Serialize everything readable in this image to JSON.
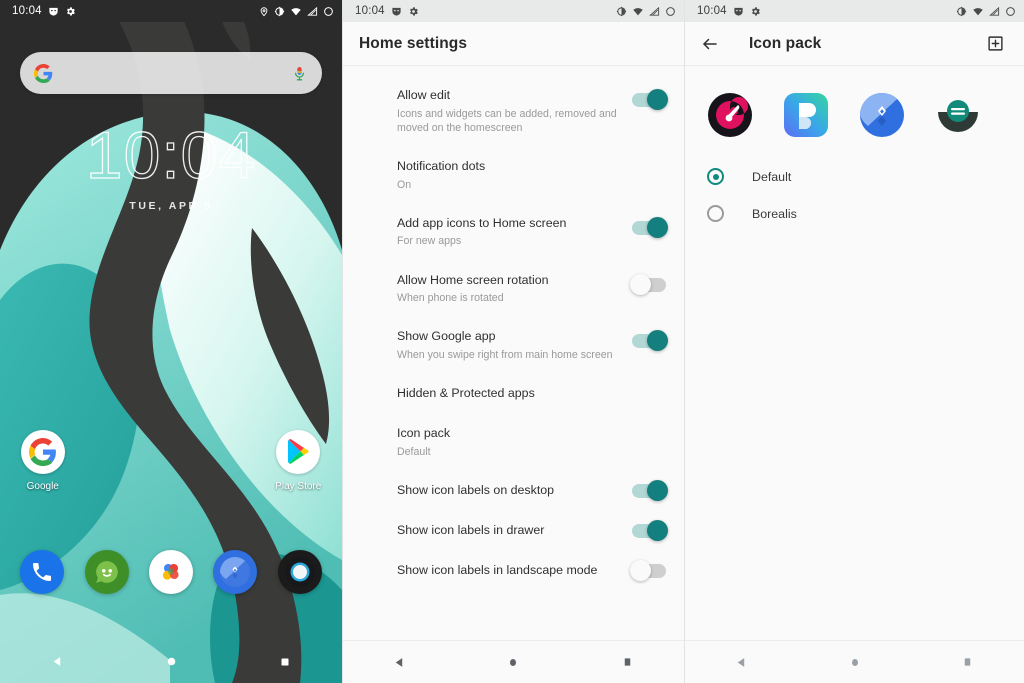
{
  "home_screen": {
    "statusbar": {
      "time": "10:04",
      "left_icons": [
        "mask-icon",
        "gear-icon"
      ],
      "right_icons": [
        "location-pin-icon",
        "brightness-icon",
        "wifi-icon",
        "signal-icon",
        "battery-icon"
      ]
    },
    "search": {
      "placeholder": "",
      "google_logo": "google-g-icon",
      "mic": "microphone-icon"
    },
    "clock_widget": {
      "time": "10:04",
      "date": "TUE, APR 5"
    },
    "apps": [
      {
        "label": "Google",
        "icon": "google-icon"
      },
      {
        "label": "Play Store",
        "icon": "play-store-icon"
      }
    ],
    "dock": [
      {
        "label": "Phone",
        "icon": "phone-icon"
      },
      {
        "label": "Messages",
        "icon": "messages-icon"
      },
      {
        "label": "Photos",
        "icon": "photos-icon"
      },
      {
        "label": "Maps",
        "icon": "maps-icon"
      },
      {
        "label": "Camera",
        "icon": "camera-icon"
      }
    ],
    "navbar": {
      "back": "back-icon",
      "home": "home-icon",
      "recents": "recents-icon"
    }
  },
  "settings_screen": {
    "statusbar": {
      "time": "10:04",
      "left_icons": [
        "mask-icon",
        "gear-icon"
      ],
      "right_icons": [
        "brightness-icon",
        "wifi-icon",
        "signal-icon",
        "battery-icon"
      ]
    },
    "title": "Home settings",
    "rows": [
      {
        "title": "Allow edit",
        "sub": "Icons and widgets can be added, removed and moved on the homescreen",
        "control": "toggle",
        "state": "on"
      },
      {
        "title": "Notification dots",
        "sub": "On",
        "control": "none",
        "state": ""
      },
      {
        "title": "Add app icons to Home screen",
        "sub": "For new apps",
        "control": "toggle",
        "state": "on"
      },
      {
        "title": "Allow Home screen rotation",
        "sub": "When phone is rotated",
        "control": "toggle",
        "state": "off"
      },
      {
        "title": "Show Google app",
        "sub": "When you swipe right from main home screen",
        "control": "toggle",
        "state": "on"
      },
      {
        "title": "Hidden & Protected apps",
        "sub": "",
        "control": "none",
        "state": ""
      },
      {
        "title": "Icon pack",
        "sub": "Default",
        "control": "none",
        "state": ""
      },
      {
        "title": "Show icon labels on desktop",
        "sub": "",
        "control": "toggle",
        "state": "on"
      },
      {
        "title": "Show icon labels in drawer",
        "sub": "",
        "control": "toggle",
        "state": "on"
      },
      {
        "title": "Show icon labels in landscape mode",
        "sub": "",
        "control": "toggle",
        "state": "off"
      }
    ],
    "navbar": {
      "back": "back-icon",
      "home": "home-icon",
      "recents": "recents-icon"
    }
  },
  "iconpack_screen": {
    "statusbar": {
      "time": "10:04",
      "left_icons": [
        "mask-icon",
        "gear-icon"
      ],
      "right_icons": [
        "brightness-icon",
        "wifi-icon",
        "signal-icon",
        "battery-icon"
      ]
    },
    "back": "back-arrow-icon",
    "title": "Icon pack",
    "action": "add-box-icon",
    "previews": [
      {
        "name": "pack-preview-dark-circle"
      },
      {
        "name": "pack-preview-blue-square"
      },
      {
        "name": "pack-preview-maps-circle"
      },
      {
        "name": "pack-preview-bowl-circle"
      }
    ],
    "options": [
      {
        "label": "Default",
        "selected": true
      },
      {
        "label": "Borealis",
        "selected": false
      }
    ],
    "navbar": {
      "back": "back-icon",
      "home": "home-icon",
      "recents": "recents-icon"
    }
  },
  "colors": {
    "toggle_on": "#147f7f",
    "toggle_track_on": "#b2d8d5",
    "toggle_off_track": "#cfcfcf",
    "radio_selected": "#0f8a7e",
    "statusbar_dark": "#2b2b2b",
    "statusbar_light": "#e8eaea",
    "surface": "#fafafa",
    "wallpaper_mint": "#a7ece2",
    "wallpaper_teal": "#57c3bb",
    "wallpaper_dark": "#3a3a38"
  }
}
